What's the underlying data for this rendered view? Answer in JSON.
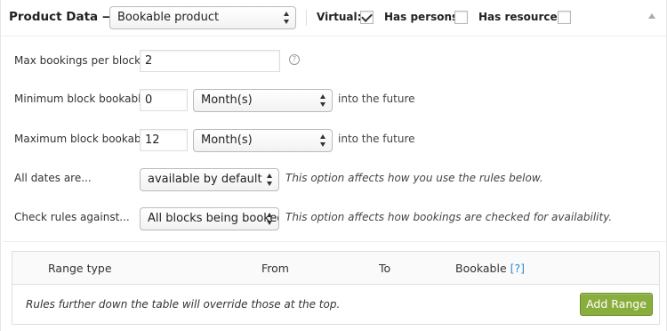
{
  "header": {
    "title": "Product Data —",
    "product_type": "Bookable product",
    "virtual_label": "Virtual:",
    "virtual_checked": true,
    "has_persons_label": "Has persons:",
    "has_persons_checked": false,
    "has_resources_label": "Has resources:",
    "has_resources_checked": false
  },
  "form": {
    "max_bookings": {
      "label": "Max bookings per block",
      "value": "2"
    },
    "min_block": {
      "label": "Minimum block bookable",
      "value": "0",
      "unit": "Month(s)",
      "suffix": "into the future"
    },
    "max_block": {
      "label": "Maximum block bookable",
      "value": "12",
      "unit": "Month(s)",
      "suffix": "into the future"
    },
    "all_dates": {
      "label": "All dates are...",
      "value": "available by default",
      "description": "This option affects how you use the rules below."
    },
    "check_rules": {
      "label": "Check rules against...",
      "value": "All blocks being booked",
      "description": "This option affects how bookings are checked for availability."
    }
  },
  "table": {
    "columns": [
      "Range type",
      "From",
      "To",
      "Bookable"
    ],
    "help_link": "[?]",
    "footer_note": "Rules further down the table will override those at the top.",
    "add_button": "Add Range"
  },
  "colors": {
    "accent_button": "#8aae3e",
    "link": "#2a8bd3"
  }
}
